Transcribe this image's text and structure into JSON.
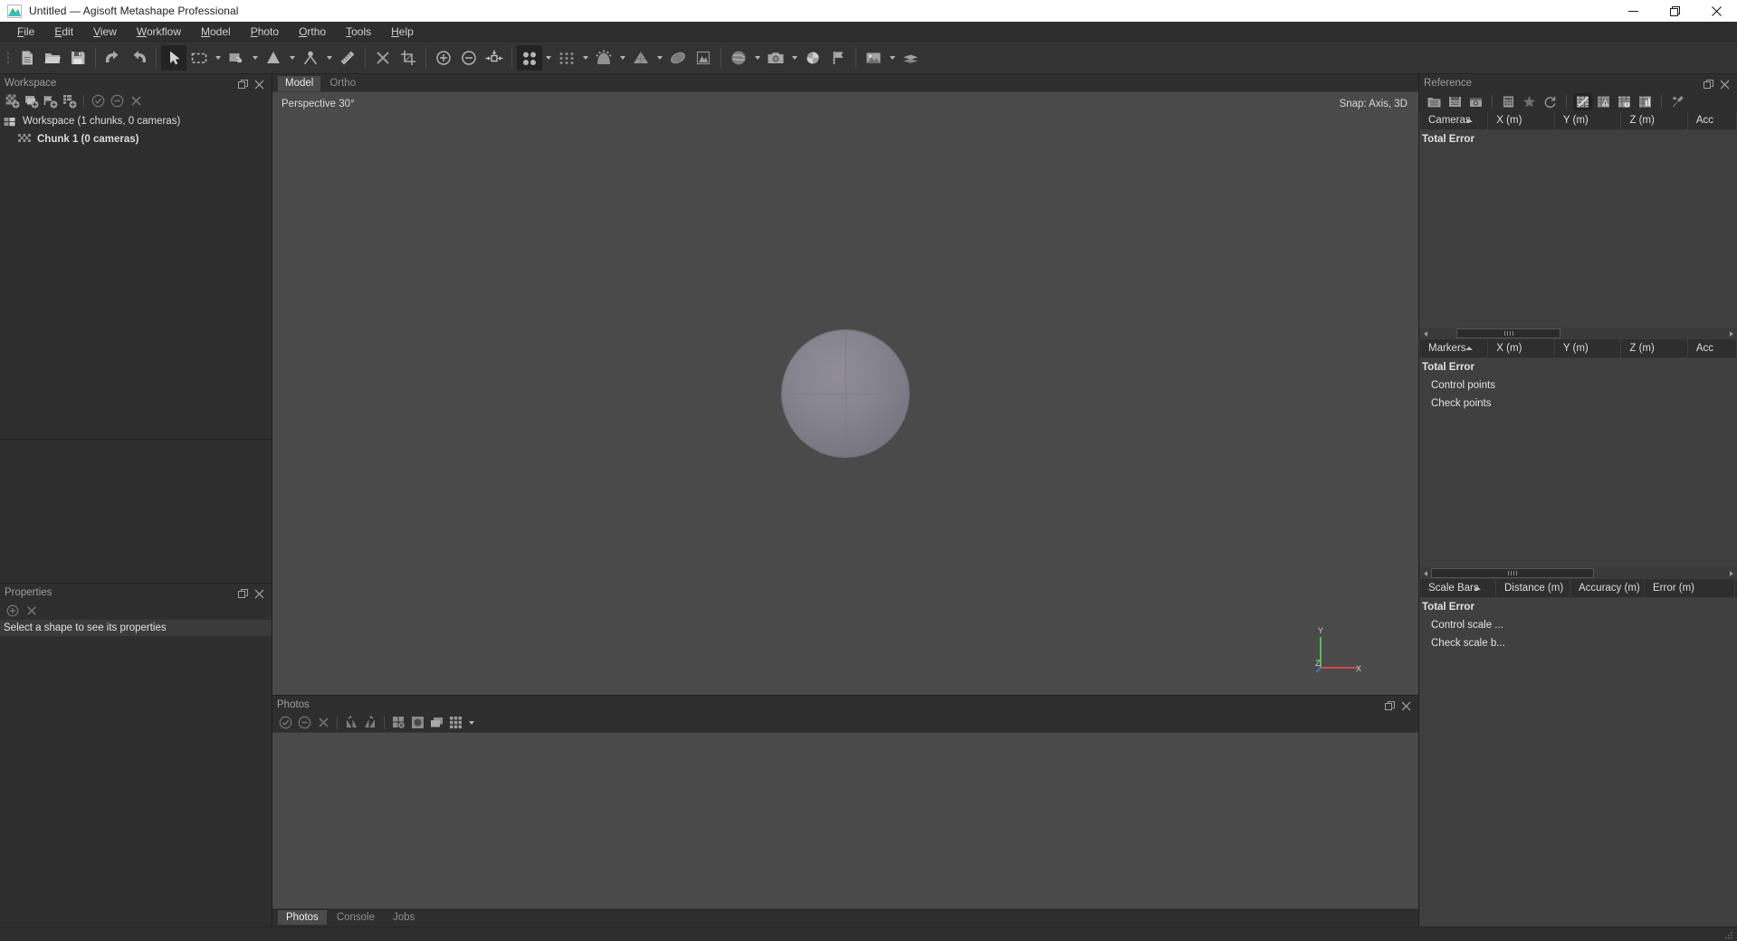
{
  "window": {
    "title": "Untitled — Agisoft Metashape Professional",
    "logo_icon": "metashape-logo-icon",
    "minimize_label": "Minimize",
    "maximize_label": "Restore",
    "close_label": "Close"
  },
  "menubar": {
    "items": [
      {
        "label": "File",
        "mnemonic": "F"
      },
      {
        "label": "Edit",
        "mnemonic": "E"
      },
      {
        "label": "View",
        "mnemonic": "V"
      },
      {
        "label": "Workflow",
        "mnemonic": "W"
      },
      {
        "label": "Model",
        "mnemonic": "M"
      },
      {
        "label": "Photo",
        "mnemonic": "P"
      },
      {
        "label": "Ortho",
        "mnemonic": "O"
      },
      {
        "label": "Tools",
        "mnemonic": "T"
      },
      {
        "label": "Help",
        "mnemonic": "H"
      }
    ]
  },
  "toolbar": {
    "buttons": [
      {
        "name": "new-project-icon",
        "tooltip": "New"
      },
      {
        "name": "open-project-icon",
        "tooltip": "Open"
      },
      {
        "name": "save-project-icon",
        "tooltip": "Save"
      },
      {
        "name": "undo-icon",
        "tooltip": "Undo"
      },
      {
        "name": "redo-icon",
        "tooltip": "Redo"
      },
      {
        "name": "navigation-cursor-icon",
        "tooltip": "Navigation",
        "active": true
      },
      {
        "name": "rectangle-selection-icon",
        "tooltip": "Rectangle Selection",
        "has_dropdown": true
      },
      {
        "name": "free-form-selection-icon",
        "tooltip": "Free-Form Selection",
        "has_dropdown": true
      },
      {
        "name": "shape-draw-icon",
        "tooltip": "Draw Shape",
        "has_dropdown": true
      },
      {
        "name": "point-measure-icon",
        "tooltip": "Add Marker",
        "has_dropdown": true
      },
      {
        "name": "ruler-icon",
        "tooltip": "Measure"
      },
      {
        "name": "delete-selection-icon",
        "tooltip": "Delete Selection"
      },
      {
        "name": "crop-selection-icon",
        "tooltip": "Crop Selection"
      },
      {
        "name": "zoom-in-icon",
        "tooltip": "Zoom In"
      },
      {
        "name": "zoom-out-icon",
        "tooltip": "Zoom Out"
      },
      {
        "name": "reset-view-icon",
        "tooltip": "Reset View"
      },
      {
        "name": "tie-points-icon",
        "tooltip": "Tie Points",
        "active": true,
        "has_dropdown": true
      },
      {
        "name": "point-cloud-icon",
        "tooltip": "Point Cloud",
        "has_dropdown": true
      },
      {
        "name": "depth-maps-icon",
        "tooltip": "Depth Maps",
        "has_dropdown": true
      },
      {
        "name": "mesh-model-icon",
        "tooltip": "3D Model",
        "has_dropdown": true
      },
      {
        "name": "tiled-model-icon",
        "tooltip": "Tiled Model"
      },
      {
        "name": "orthomosaic-icon",
        "tooltip": "Orthomosaic"
      },
      {
        "name": "globe-view-icon",
        "tooltip": "Show Region",
        "has_dropdown": true
      },
      {
        "name": "camera-icon",
        "tooltip": "Show Cameras",
        "has_dropdown": true
      },
      {
        "name": "markers-icon",
        "tooltip": "Show Markers"
      },
      {
        "name": "shapes-flag-icon",
        "tooltip": "Show Shapes"
      },
      {
        "name": "images-icon",
        "tooltip": "Show Images",
        "has_dropdown": true
      },
      {
        "name": "layers-icon",
        "tooltip": "Show Layers"
      }
    ]
  },
  "workspace": {
    "title": "Workspace",
    "header_buttons": [
      {
        "name": "restore-panel-icon"
      },
      {
        "name": "close-panel-icon"
      }
    ],
    "toolbar": [
      {
        "name": "add-chunk-icon"
      },
      {
        "name": "add-photos-icon"
      },
      {
        "name": "add-folder-icon"
      },
      {
        "name": "add-markers-icon"
      },
      {
        "name": "enable-icon"
      },
      {
        "name": "disable-icon"
      },
      {
        "name": "remove-items-icon"
      }
    ],
    "tree": [
      {
        "label": "Workspace (1 chunks, 0 cameras)",
        "icon": "workspace-icon",
        "indent": 0,
        "bold": false
      },
      {
        "label": "Chunk 1 (0 cameras)",
        "icon": "chunk-icon",
        "indent": 1,
        "bold": true
      }
    ]
  },
  "properties": {
    "title": "Properties",
    "toolbar": [
      {
        "name": "add-property-icon"
      },
      {
        "name": "remove-property-icon"
      }
    ],
    "status_text": "Select a shape to see its properties"
  },
  "viewport": {
    "tabs": [
      {
        "label": "Model",
        "active": true
      },
      {
        "label": "Ortho",
        "active": false
      }
    ],
    "projection_label": "Perspective 30°",
    "snap_label": "Snap: Axis, 3D",
    "axis_labels": {
      "x": "X",
      "y": "Y",
      "z": "Z"
    },
    "axis_colors": {
      "x": "#d04a4a",
      "y": "#4fbf4f",
      "z": "#4a6fd0"
    }
  },
  "photos": {
    "title": "Photos",
    "header_buttons": [
      {
        "name": "restore-panel-icon"
      },
      {
        "name": "close-panel-icon"
      }
    ],
    "toolbar": [
      {
        "name": "enable-photos-icon"
      },
      {
        "name": "disable-photos-icon"
      },
      {
        "name": "remove-photos-icon"
      },
      {
        "name": "rotate-left-icon"
      },
      {
        "name": "rotate-right-icon"
      },
      {
        "name": "reset-masks-icon"
      },
      {
        "name": "show-masked-icon"
      },
      {
        "name": "detail-view-icon"
      },
      {
        "name": "thumbnail-size-icon",
        "has_dropdown": true
      }
    ]
  },
  "bottom_tabs": [
    {
      "label": "Photos",
      "active": true
    },
    {
      "label": "Console",
      "active": false
    },
    {
      "label": "Jobs",
      "active": false
    }
  ],
  "reference": {
    "title": "Reference",
    "header_buttons": [
      {
        "name": "restore-panel-icon"
      },
      {
        "name": "close-panel-icon"
      }
    ],
    "toolbar": [
      {
        "name": "import-reference-icon"
      },
      {
        "name": "export-reference-icon"
      },
      {
        "name": "camera-calibration-icon"
      },
      {
        "name": "convert-reference-icon"
      },
      {
        "name": "optimize-cameras-icon"
      },
      {
        "name": "update-transform-icon"
      },
      {
        "name": "view-estimated-icon",
        "active": true
      },
      {
        "name": "view-errors-icon"
      },
      {
        "name": "view-source-icon"
      },
      {
        "name": "view-variance-icon"
      },
      {
        "name": "reference-settings-icon"
      }
    ],
    "sections": [
      {
        "name": "cameras",
        "columns": [
          "Cameras",
          "X (m)",
          "Y (m)",
          "Z (m)",
          "Acc"
        ],
        "sorted_column": 0,
        "rows": [
          {
            "label": "Total Error",
            "bold": true,
            "indent": 0
          }
        ]
      },
      {
        "name": "markers",
        "columns": [
          "Markers",
          "X (m)",
          "Y (m)",
          "Z (m)",
          "Acc"
        ],
        "sorted_column": 0,
        "rows": [
          {
            "label": "Total Error",
            "bold": true,
            "indent": 0
          },
          {
            "label": "Control points",
            "bold": false,
            "indent": 1
          },
          {
            "label": "Check points",
            "bold": false,
            "indent": 1
          }
        ]
      },
      {
        "name": "scale-bars",
        "columns": [
          "Scale Bars",
          "Distance (m)",
          "Accuracy (m)",
          "Error (m)"
        ],
        "sorted_column": 0,
        "rows": [
          {
            "label": "Total Error",
            "bold": true,
            "indent": 0
          },
          {
            "label": "Control scale ...",
            "bold": false,
            "indent": 1
          },
          {
            "label": "Check scale b...",
            "bold": false,
            "indent": 1
          }
        ]
      }
    ]
  },
  "statusbar": {
    "resize_grip": "resize-grip-icon"
  }
}
